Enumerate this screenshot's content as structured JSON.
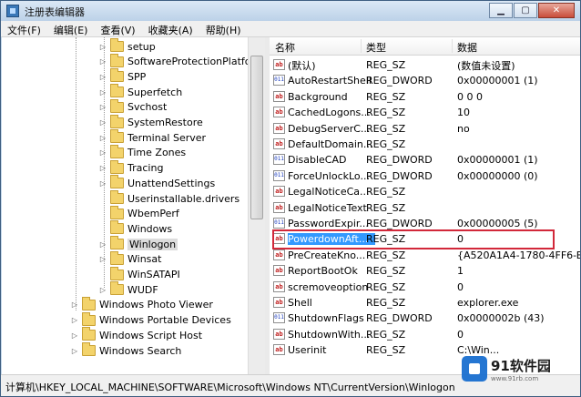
{
  "window": {
    "title": "注册表编辑器"
  },
  "menu": [
    "文件(F)",
    "编辑(E)",
    "查看(V)",
    "收藏夹(A)",
    "帮助(H)"
  ],
  "tree": {
    "items": [
      {
        "label": "setup",
        "level": 2,
        "expandable": true,
        "selected": false
      },
      {
        "label": "SoftwareProtectionPlatform",
        "level": 2,
        "expandable": true,
        "selected": false
      },
      {
        "label": "SPP",
        "level": 2,
        "expandable": true,
        "selected": false
      },
      {
        "label": "Superfetch",
        "level": 2,
        "expandable": true,
        "selected": false
      },
      {
        "label": "Svchost",
        "level": 2,
        "expandable": true,
        "selected": false
      },
      {
        "label": "SystemRestore",
        "level": 2,
        "expandable": true,
        "selected": false
      },
      {
        "label": "Terminal Server",
        "level": 2,
        "expandable": true,
        "selected": false
      },
      {
        "label": "Time Zones",
        "level": 2,
        "expandable": true,
        "selected": false
      },
      {
        "label": "Tracing",
        "level": 2,
        "expandable": true,
        "selected": false
      },
      {
        "label": "UnattendSettings",
        "level": 2,
        "expandable": true,
        "selected": false
      },
      {
        "label": "Userinstallable.drivers",
        "level": 2,
        "expandable": false,
        "selected": false
      },
      {
        "label": "WbemPerf",
        "level": 2,
        "expandable": false,
        "selected": false
      },
      {
        "label": "Windows",
        "level": 2,
        "expandable": false,
        "selected": false
      },
      {
        "label": "Winlogon",
        "level": 2,
        "expandable": true,
        "selected": true
      },
      {
        "label": "Winsat",
        "level": 2,
        "expandable": true,
        "selected": false
      },
      {
        "label": "WinSATAPI",
        "level": 2,
        "expandable": false,
        "selected": false
      },
      {
        "label": "WUDF",
        "level": 2,
        "expandable": true,
        "selected": false
      },
      {
        "label": "Windows Photo Viewer",
        "level": 1,
        "expandable": true,
        "selected": false
      },
      {
        "label": "Windows Portable Devices",
        "level": 1,
        "expandable": true,
        "selected": false
      },
      {
        "label": "Windows Script Host",
        "level": 1,
        "expandable": true,
        "selected": false
      },
      {
        "label": "Windows Search",
        "level": 1,
        "expandable": true,
        "selected": false
      }
    ]
  },
  "columns": {
    "name": "名称",
    "type": "类型",
    "data": "数据"
  },
  "values": [
    {
      "name": "(默认)",
      "type": "REG_SZ",
      "data": "(数值未设置)",
      "kind": "sz",
      "selected": false
    },
    {
      "name": "AutoRestartShell",
      "type": "REG_DWORD",
      "data": "0x00000001 (1)",
      "kind": "dw",
      "selected": false
    },
    {
      "name": "Background",
      "type": "REG_SZ",
      "data": "0 0 0",
      "kind": "sz",
      "selected": false
    },
    {
      "name": "CachedLogons...",
      "type": "REG_SZ",
      "data": "10",
      "kind": "sz",
      "selected": false
    },
    {
      "name": "DebugServerC...",
      "type": "REG_SZ",
      "data": "no",
      "kind": "sz",
      "selected": false
    },
    {
      "name": "DefaultDomain...",
      "type": "REG_SZ",
      "data": "",
      "kind": "sz",
      "selected": false
    },
    {
      "name": "DisableCAD",
      "type": "REG_DWORD",
      "data": "0x00000001 (1)",
      "kind": "dw",
      "selected": false
    },
    {
      "name": "ForceUnlockLo...",
      "type": "REG_DWORD",
      "data": "0x00000000 (0)",
      "kind": "dw",
      "selected": false
    },
    {
      "name": "LegalNoticeCa...",
      "type": "REG_SZ",
      "data": "",
      "kind": "sz",
      "selected": false
    },
    {
      "name": "LegalNoticeText",
      "type": "REG_SZ",
      "data": "",
      "kind": "sz",
      "selected": false
    },
    {
      "name": "PasswordExpir...",
      "type": "REG_DWORD",
      "data": "0x00000005 (5)",
      "kind": "dw",
      "selected": false
    },
    {
      "name": "PowerdownAft...",
      "type": "REG_SZ",
      "data": "0",
      "kind": "sz",
      "selected": true
    },
    {
      "name": "PreCreateKno...",
      "type": "REG_SZ",
      "data": "{A520A1A4-1780-4FF6-B",
      "kind": "sz",
      "selected": false
    },
    {
      "name": "ReportBootOk",
      "type": "REG_SZ",
      "data": "1",
      "kind": "sz",
      "selected": false
    },
    {
      "name": "scremoveoption",
      "type": "REG_SZ",
      "data": "0",
      "kind": "sz",
      "selected": false
    },
    {
      "name": "Shell",
      "type": "REG_SZ",
      "data": "explorer.exe",
      "kind": "sz",
      "selected": false
    },
    {
      "name": "ShutdownFlags",
      "type": "REG_DWORD",
      "data": "0x0000002b (43)",
      "kind": "dw",
      "selected": false
    },
    {
      "name": "ShutdownWith...",
      "type": "REG_SZ",
      "data": "0",
      "kind": "sz",
      "selected": false
    },
    {
      "name": "Userinit",
      "type": "REG_SZ",
      "data": "C:\\Win...",
      "kind": "sz",
      "selected": false
    }
  ],
  "status": {
    "path": "计算机\\HKEY_LOCAL_MACHINE\\SOFTWARE\\Microsoft\\Windows NT\\CurrentVersion\\Winlogon"
  },
  "watermark": {
    "main": "91软件园",
    "sub": "www.91rb.com"
  },
  "icons": {
    "value_sz": "ab",
    "value_dword": "011"
  },
  "colors": {
    "selection": "#3399ff",
    "highlight_box": "#d2283a",
    "folder": "#f3d36b"
  }
}
